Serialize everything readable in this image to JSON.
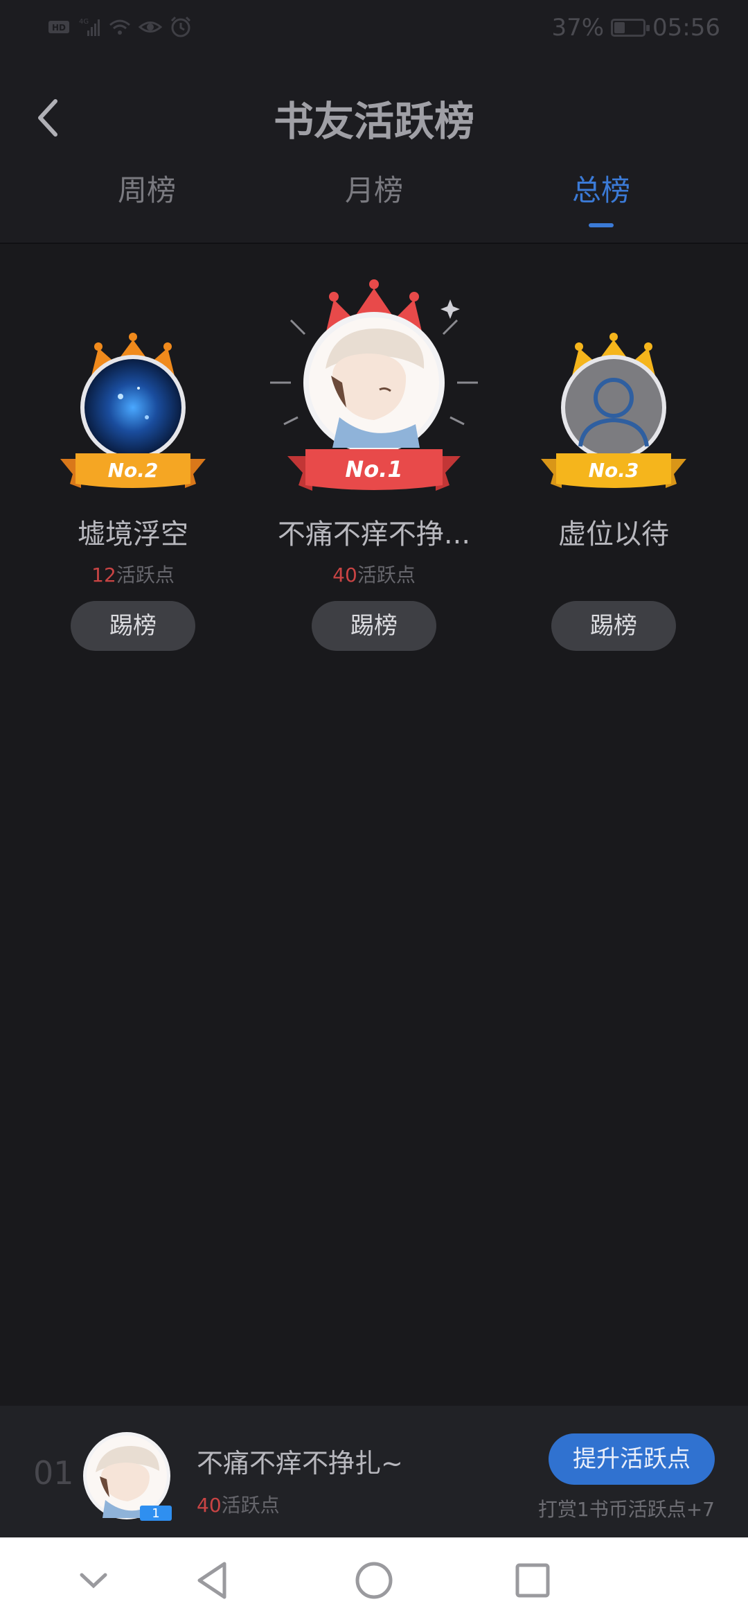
{
  "status_bar": {
    "battery": "37%",
    "battery_level": 0.37,
    "time": "05:56",
    "left_icons": [
      "hd-icon",
      "signal-4g-icon",
      "wifi-icon",
      "eye-icon",
      "alarm-icon"
    ]
  },
  "header": {
    "title": "书友活跃榜",
    "back_icon": "chevron-left-icon"
  },
  "tabs": [
    {
      "label": "周榜",
      "active": false
    },
    {
      "label": "月榜",
      "active": false
    },
    {
      "label": "总榜",
      "active": true
    }
  ],
  "podium": [
    {
      "rank_badge": "No.2",
      "name": "墟境浮空",
      "points_value": "12",
      "points_unit": "活跃点",
      "action": "踢榜"
    },
    {
      "rank_badge": "No.1",
      "name": "不痛不痒不挣...",
      "points_value": "40",
      "points_unit": "活跃点",
      "action": "踢榜"
    },
    {
      "rank_badge": "No.3",
      "name": "虚位以待",
      "points_value": "",
      "points_unit": "",
      "action": "踢榜"
    }
  ],
  "my_rank": {
    "index": "01",
    "badge": "1",
    "name": "不痛不痒不挣扎~",
    "points_value": "40",
    "points_unit": "活跃点",
    "button": "提升活跃点",
    "hint": "打赏1书币活跃点+7"
  },
  "colors": {
    "accent": "#3b7ad6",
    "points": "#c94444",
    "crown_gold": "#f5a623",
    "crown_orange": "#f08a1c",
    "crown_red": "#e84a4a"
  },
  "nav_bar": {
    "icons": [
      "chevron-down-icon",
      "back-triangle-icon",
      "home-circle-icon",
      "recents-square-icon"
    ]
  }
}
